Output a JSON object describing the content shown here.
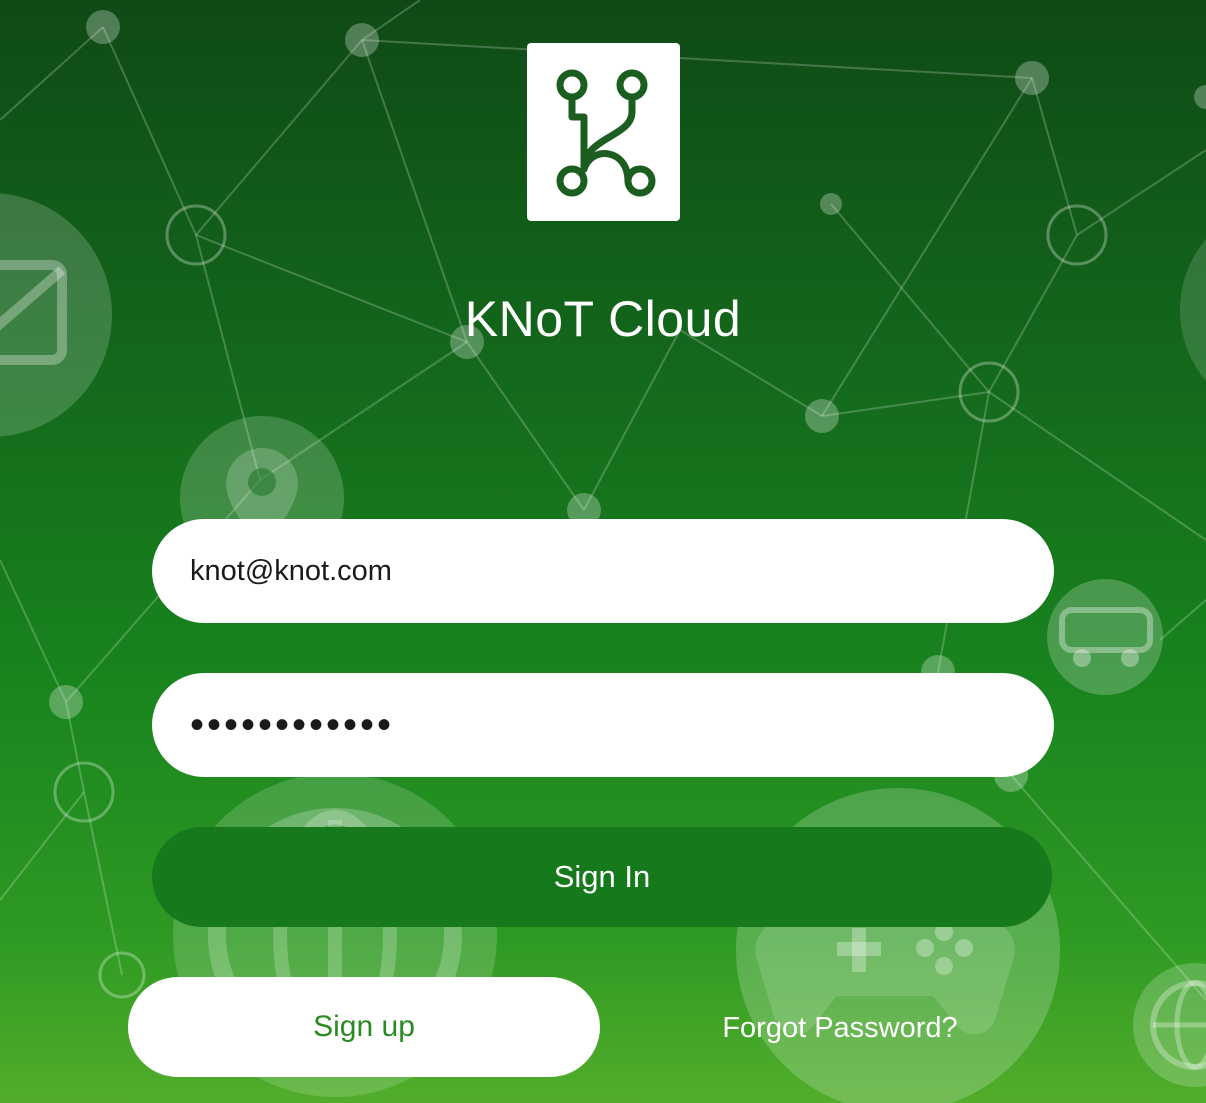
{
  "app": {
    "title": "KNoT Cloud",
    "logo_icon": "knot-logo-icon"
  },
  "login_form": {
    "email": {
      "value": "knot@knot.com",
      "type": "email"
    },
    "password": {
      "value": "••••••••••••",
      "type": "password"
    },
    "signin_label": "Sign In",
    "signup_label": "Sign up",
    "forgot_label": "Forgot Password?"
  },
  "background": {
    "description_icons": [
      "mail-icon",
      "location-pin-icon",
      "globe-icon",
      "car-icon",
      "gamepad-icon"
    ]
  },
  "colors": {
    "background_top": "#0f4a16",
    "background_bottom": "#52ad2b",
    "primary_button": "#167a1c",
    "signup_text": "#2a8a24",
    "logo_stroke": "#1b5e20"
  }
}
